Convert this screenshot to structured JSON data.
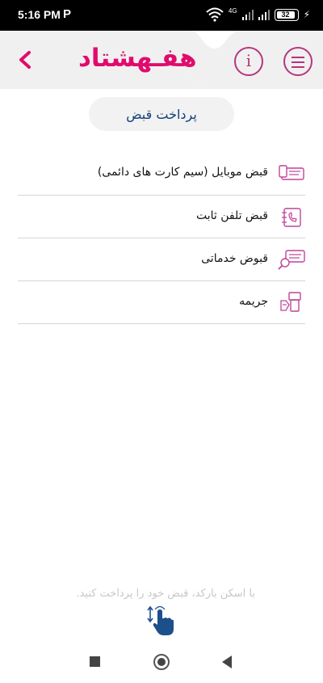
{
  "status_bar": {
    "time": "5:16 PM",
    "app_glyph": "P",
    "network": "4G",
    "battery": "32",
    "icons": [
      "wifi-icon",
      "signal-icon",
      "battery-icon",
      "charging-icon"
    ]
  },
  "header": {
    "logo": "هفـهشتاد",
    "back_icon": "chevron-left-icon",
    "info_icon": "info-icon",
    "info_glyph": "i",
    "menu_icon": "hamburger-menu-icon",
    "accent_color": "#e10b6d",
    "icon_color": "#b6357f"
  },
  "page": {
    "title": "پرداخت قبض",
    "title_color": "#103f7a"
  },
  "bills": [
    {
      "label": "قبض موبایل (سیم کارت های دائمی)",
      "icon": "mobile-bill-icon"
    },
    {
      "label": "قبض تلفن ثابت",
      "icon": "landline-phone-icon"
    },
    {
      "label": "قبوض خدماتی",
      "icon": "utility-bills-icon"
    },
    {
      "label": "جریمه",
      "icon": "fine-icon"
    }
  ],
  "footer": {
    "hint": "با اسکن بارکد، قبض خود را پرداخت کنید.",
    "scan_icon": "barcode-scan-icon"
  },
  "nav": {
    "icons": [
      "recents-icon",
      "home-icon",
      "back-icon"
    ]
  }
}
